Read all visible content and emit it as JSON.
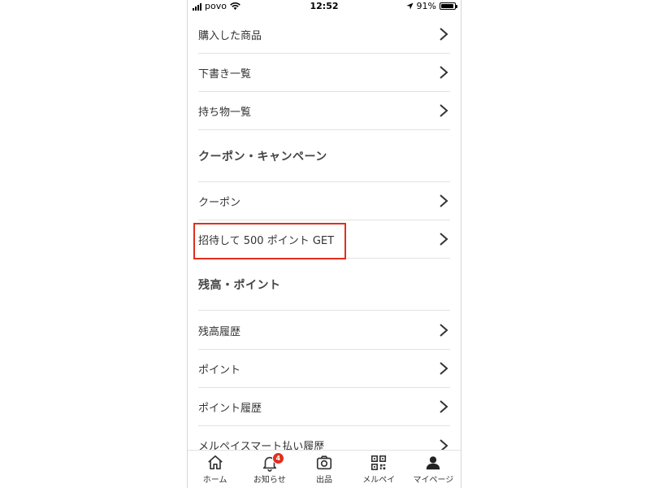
{
  "status_bar": {
    "carrier": "povo",
    "time": "12:52",
    "battery_pct": "91%",
    "battery_level": 0.91
  },
  "menu": {
    "purchases": [
      {
        "label": "購入した商品",
        "icon": "chevron-right-icon"
      },
      {
        "label": "下書き一覧",
        "icon": "chevron-right-icon"
      },
      {
        "label": "持ち物一覧",
        "icon": "chevron-right-icon"
      }
    ],
    "coupon_section": {
      "heading": "クーポン・キャンペーン",
      "items": [
        {
          "label": "クーポン",
          "icon": "chevron-right-icon"
        },
        {
          "label": "招待して 500 ポイント GET",
          "icon": "chevron-right-icon",
          "highlighted": true
        }
      ]
    },
    "balance_section": {
      "heading": "残高・ポイント",
      "items": [
        {
          "label": "残高履歴",
          "icon": "chevron-right-icon"
        },
        {
          "label": "ポイント",
          "icon": "chevron-right-icon"
        },
        {
          "label": "ポイント履歴",
          "icon": "chevron-right-icon"
        },
        {
          "label": "メルペイスマート払い履歴",
          "icon": "chevron-right-icon"
        }
      ]
    }
  },
  "tab_bar": {
    "tabs": [
      {
        "label": "ホーム",
        "icon": "home-icon"
      },
      {
        "label": "お知らせ",
        "icon": "bell-icon",
        "badge": "4"
      },
      {
        "label": "出品",
        "icon": "camera-icon"
      },
      {
        "label": "メルペイ",
        "icon": "qr-code-icon"
      },
      {
        "label": "マイページ",
        "icon": "person-icon",
        "active": true
      }
    ]
  },
  "colors": {
    "highlight": "#e0301e",
    "badge": "#e0301e",
    "divider": "#e2e2e2"
  }
}
